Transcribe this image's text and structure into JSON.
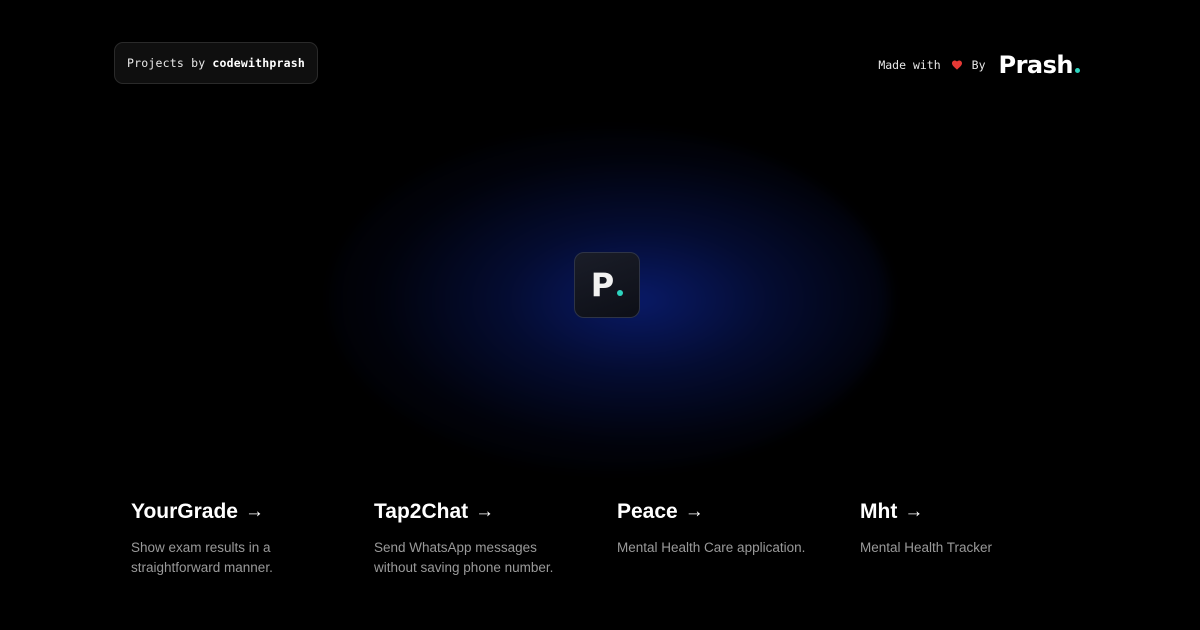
{
  "header": {
    "badge_prefix": "Projects by",
    "badge_handle": "codewithprash",
    "made_with": "Made with",
    "by": "By",
    "brand_name": "Prash",
    "heart_icon": "heart-icon",
    "heart_color": "#e53935",
    "accent_color": "#2dd4bf"
  },
  "logo": {
    "letter": "P"
  },
  "projects": [
    {
      "title": "YourGrade",
      "arrow": "→",
      "description": "Show exam results in a straightforward manner."
    },
    {
      "title": "Tap2Chat",
      "arrow": "→",
      "description": "Send WhatsApp messages without saving phone number."
    },
    {
      "title": "Peace",
      "arrow": "→",
      "description": "Mental Health Care application."
    },
    {
      "title": "Mht",
      "arrow": "→",
      "description": "Mental Health Tracker"
    }
  ]
}
